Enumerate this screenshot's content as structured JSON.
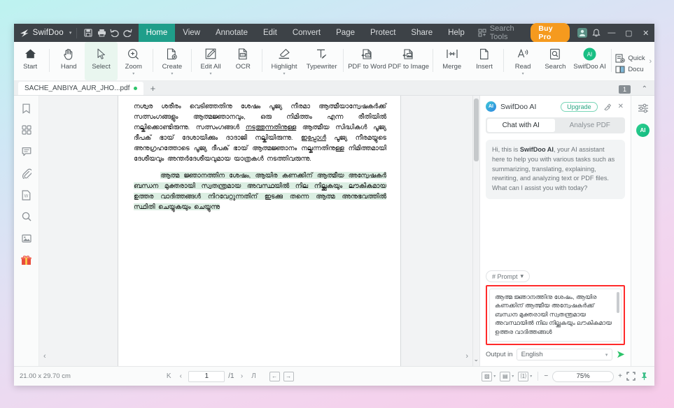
{
  "titlebar": {
    "brand": "SwifDoo",
    "brand_caret": "▾",
    "quick_actions": [
      {
        "name": "save-icon",
        "glyph": "save"
      },
      {
        "name": "print-icon",
        "glyph": "print"
      },
      {
        "name": "undo-icon",
        "glyph": "undo"
      },
      {
        "name": "redo-icon",
        "glyph": "redo"
      }
    ],
    "menu": [
      {
        "label": "Home",
        "active": true
      },
      {
        "label": "View",
        "active": false
      },
      {
        "label": "Annotate",
        "active": false
      },
      {
        "label": "Edit",
        "active": false
      },
      {
        "label": "Convert",
        "active": false
      },
      {
        "label": "Page",
        "active": false
      },
      {
        "label": "Protect",
        "active": false
      },
      {
        "label": "Share",
        "active": false
      },
      {
        "label": "Help",
        "active": false
      }
    ],
    "search_placeholder": "Search Tools",
    "buy_pro": "Buy Pro",
    "minimize": "—",
    "maximize": "▢",
    "close": "✕",
    "accent_active": "#1f9e8a",
    "accent_buypro": "#f59a1e"
  },
  "ribbon": {
    "items": [
      {
        "label": "Start",
        "icon": "home-icon",
        "caret": false,
        "selected": false
      },
      {
        "label": "Hand",
        "icon": "hand-icon",
        "caret": false,
        "selected": false
      },
      {
        "label": "Select",
        "icon": "cursor-icon",
        "caret": false,
        "selected": true
      },
      {
        "label": "Zoom",
        "icon": "zoom-in-icon",
        "caret": true,
        "selected": false
      },
      {
        "label": "Create",
        "icon": "create-file-icon",
        "caret": true,
        "selected": false
      },
      {
        "label": "Edit All",
        "icon": "edit-all-icon",
        "caret": true,
        "selected": false
      },
      {
        "label": "OCR",
        "icon": "ocr-icon",
        "caret": false,
        "selected": false
      },
      {
        "label": "Highlight",
        "icon": "highlight-icon",
        "caret": true,
        "selected": false
      },
      {
        "label": "Typewriter",
        "icon": "typewriter-icon",
        "caret": false,
        "selected": false
      },
      {
        "label": "PDF to Word",
        "icon": "pdf-to-word-icon",
        "caret": false,
        "selected": false
      },
      {
        "label": "PDF to Image",
        "icon": "pdf-to-image-icon",
        "caret": false,
        "selected": false
      },
      {
        "label": "Merge",
        "icon": "merge-icon",
        "caret": false,
        "selected": false
      },
      {
        "label": "Insert",
        "icon": "insert-icon",
        "caret": false,
        "selected": false
      },
      {
        "label": "Read",
        "icon": "read-aloud-icon",
        "caret": true,
        "selected": false
      },
      {
        "label": "Search",
        "icon": "search-doc-icon",
        "caret": false,
        "selected": false
      },
      {
        "label": "SwifDoo AI",
        "icon": "swifdoo-ai-icon",
        "caret": false,
        "selected": false
      }
    ],
    "stack": [
      {
        "label": "Quick",
        "icon": "quick-sign-icon"
      },
      {
        "label": "Docu",
        "icon": "document-compare-icon"
      }
    ],
    "overflow": "›"
  },
  "tabstrip": {
    "document_tab": "SACHE_ANBIYA_AUR_JHO...pdf",
    "new_tab": "+",
    "page_badge": "1",
    "collapse": "⌃"
  },
  "left_rail": [
    {
      "name": "bookmark-icon"
    },
    {
      "name": "thumbnails-icon"
    },
    {
      "name": "comments-icon"
    },
    {
      "name": "attachment-icon"
    },
    {
      "name": "word-export-icon"
    },
    {
      "name": "search-icon"
    },
    {
      "name": "images-icon"
    },
    {
      "name": "gift-icon"
    }
  ],
  "document": {
    "paragraphs": [
      {
        "indent": false,
        "highlight": false,
        "runs": [
          {
            "text": "നശ്വര ശരീരം വെടിഞ്ഞതിനു ശേഷം പൂജ്യ നീരമാ ആത്മീയാന്വേഷകർക്ക് സത്സംഗങ്ങളും ആത്മജ്ഞാനവും, ഒരു നിമിത്തം എന്ന രീതിയിൽ നല്കിക്കൊണ്ടിരുന്നു. സത്സംഗങ്ങൾ ",
            "underline": false
          },
          {
            "text": "നടത്തുന്നതിനുള്ള",
            "underline": true
          },
          {
            "text": " ആത്മീയ സിദ്ധികൾ പൂജ്യ ദീപക് ഭായ് ദേശായിക്കും ദാദാജി നല്കിയിരുന്നു. ",
            "underline": false
          },
          {
            "text": "ഇപ്പോൾ",
            "underline": true
          },
          {
            "text": " പൂജ്യ നീരമയ്യുടെ അനുഗ്രഹത്തോടെ പൂജ്യ ദീപക് ഭായ് ആത്മജ്ഞാനം നല്കുന്നതിനുള്ള നിമിത്തമായി ദേശീയവും അന്തർദേശീയവുമായ യാത്രകൾ നടത്തിവരുന്നു.",
            "underline": false
          }
        ]
      },
      {
        "indent": true,
        "highlight": true,
        "runs": [
          {
            "text": "ആത്മ ജ്ഞാനത്തിന ശേഷം, ആയിര കണക്കിന് ആത്മീയ അന്വേഷകർ ബന്ധന മുക്തരായി സ്വതന്ത്രമായ അവസ്ഥയിൽ നില നില്ക്കുകയും ലൗകികമായ ഉത്തര വാദിത്തങ്ങൾ നിറവേറ്റുന്നതിന് ഇടക്കു തന്നെ ആത്മ അനുഭവത്തിൽ സ്ഥിതി ചെയ്യുകയും ചെയ്യുന്നു",
            "underline": false
          }
        ]
      }
    ]
  },
  "ai_panel": {
    "badge": "AI",
    "title": "SwifDoo AI",
    "upgrade": "Upgrade",
    "clear_icon": "clear-chat-icon",
    "close_icon": "close-icon",
    "tabs": [
      {
        "label": "Chat with AI",
        "active": true
      },
      {
        "label": "Analyse PDF",
        "active": false
      }
    ],
    "greeting_prefix": "Hi, this is ",
    "greeting_brand": "SwifDoo AI",
    "greeting_suffix": ", your AI assistant here to help you with various tasks such as summarizing, translating, explaining, rewriting, and analyzing text or PDF files. What can I assist you with today?",
    "prompt_chip": "# Prompt",
    "prompt_chip_caret": "▾",
    "prompt_value": "ആത്മ ജ്ഞാനത്തിനു ശേഷം, ആയിര കണക്കിന് ആത്മീയ അന്വേഷകർക്ക് ബന്ധന മുക്തരായി സ്വതന്ത്രമായ അവസ്ഥയിൽ നില നില്ക്കുകയും ലൗകികമായ ഉത്തര വാദിത്തങ്ങൾ",
    "output_label": "Output in",
    "output_value": "English",
    "output_caret": "▾",
    "send_icon": "send-icon",
    "highlight_border_color": "#ff2a2a"
  },
  "right_rail": [
    {
      "name": "settings-sliders-icon"
    },
    {
      "name": "swifdoo-ai-button",
      "label": "AI"
    }
  ],
  "statusbar": {
    "page_size": "21.00 x 29.70 cm",
    "first_page": "K",
    "prev_page": "‹",
    "current_page": "1",
    "total_pages": "/1",
    "next_page": "›",
    "last_page": "Л",
    "fit_prev_icon": "scroll-left-icon",
    "fit_next_icon": "scroll-right-icon",
    "view_mode_icons": [
      "page-fit-icon",
      "single-page-icon",
      "continuous-icon"
    ],
    "zoom_out": "−",
    "zoom_value": "75%",
    "zoom_in": "+",
    "fullscreen_icon": "fullscreen-icon",
    "pin_icon": "pin-icon"
  }
}
